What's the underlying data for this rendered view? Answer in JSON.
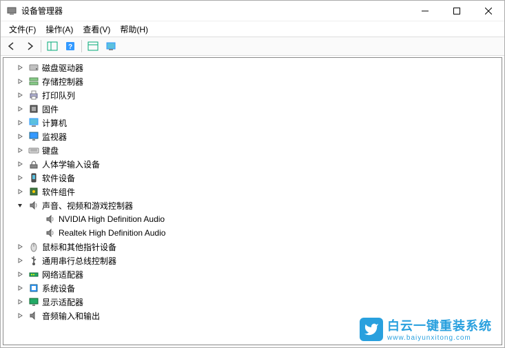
{
  "window": {
    "title": "设备管理器"
  },
  "menu": {
    "file": "文件(F)",
    "action": "操作(A)",
    "view": "查看(V)",
    "help": "帮助(H)"
  },
  "tree": {
    "items": [
      {
        "label": "磁盘驱动器",
        "icon": "disk",
        "expanded": false,
        "children": []
      },
      {
        "label": "存储控制器",
        "icon": "storage",
        "expanded": false,
        "children": []
      },
      {
        "label": "打印队列",
        "icon": "printer",
        "expanded": false,
        "children": []
      },
      {
        "label": "固件",
        "icon": "firmware",
        "expanded": false,
        "children": []
      },
      {
        "label": "计算机",
        "icon": "computer",
        "expanded": false,
        "children": []
      },
      {
        "label": "监视器",
        "icon": "monitor",
        "expanded": false,
        "children": []
      },
      {
        "label": "键盘",
        "icon": "keyboard",
        "expanded": false,
        "children": []
      },
      {
        "label": "人体学输入设备",
        "icon": "hid",
        "expanded": false,
        "children": []
      },
      {
        "label": "软件设备",
        "icon": "software",
        "expanded": false,
        "children": []
      },
      {
        "label": "软件组件",
        "icon": "component",
        "expanded": false,
        "children": []
      },
      {
        "label": "声音、视频和游戏控制器",
        "icon": "sound",
        "expanded": true,
        "children": [
          {
            "label": "NVIDIA High Definition Audio",
            "icon": "sound"
          },
          {
            "label": "Realtek High Definition Audio",
            "icon": "sound"
          }
        ]
      },
      {
        "label": "鼠标和其他指针设备",
        "icon": "mouse",
        "expanded": false,
        "children": []
      },
      {
        "label": "通用串行总线控制器",
        "icon": "usb",
        "expanded": false,
        "children": []
      },
      {
        "label": "网络适配器",
        "icon": "network",
        "expanded": false,
        "children": []
      },
      {
        "label": "系统设备",
        "icon": "system",
        "expanded": false,
        "children": []
      },
      {
        "label": "显示适配器",
        "icon": "display",
        "expanded": false,
        "children": []
      },
      {
        "label": "音频输入和输出",
        "icon": "audio-io",
        "expanded": false,
        "children": []
      }
    ]
  },
  "watermark": {
    "title": "白云一键重装系统",
    "url": "www.baiyunxitong.com"
  }
}
